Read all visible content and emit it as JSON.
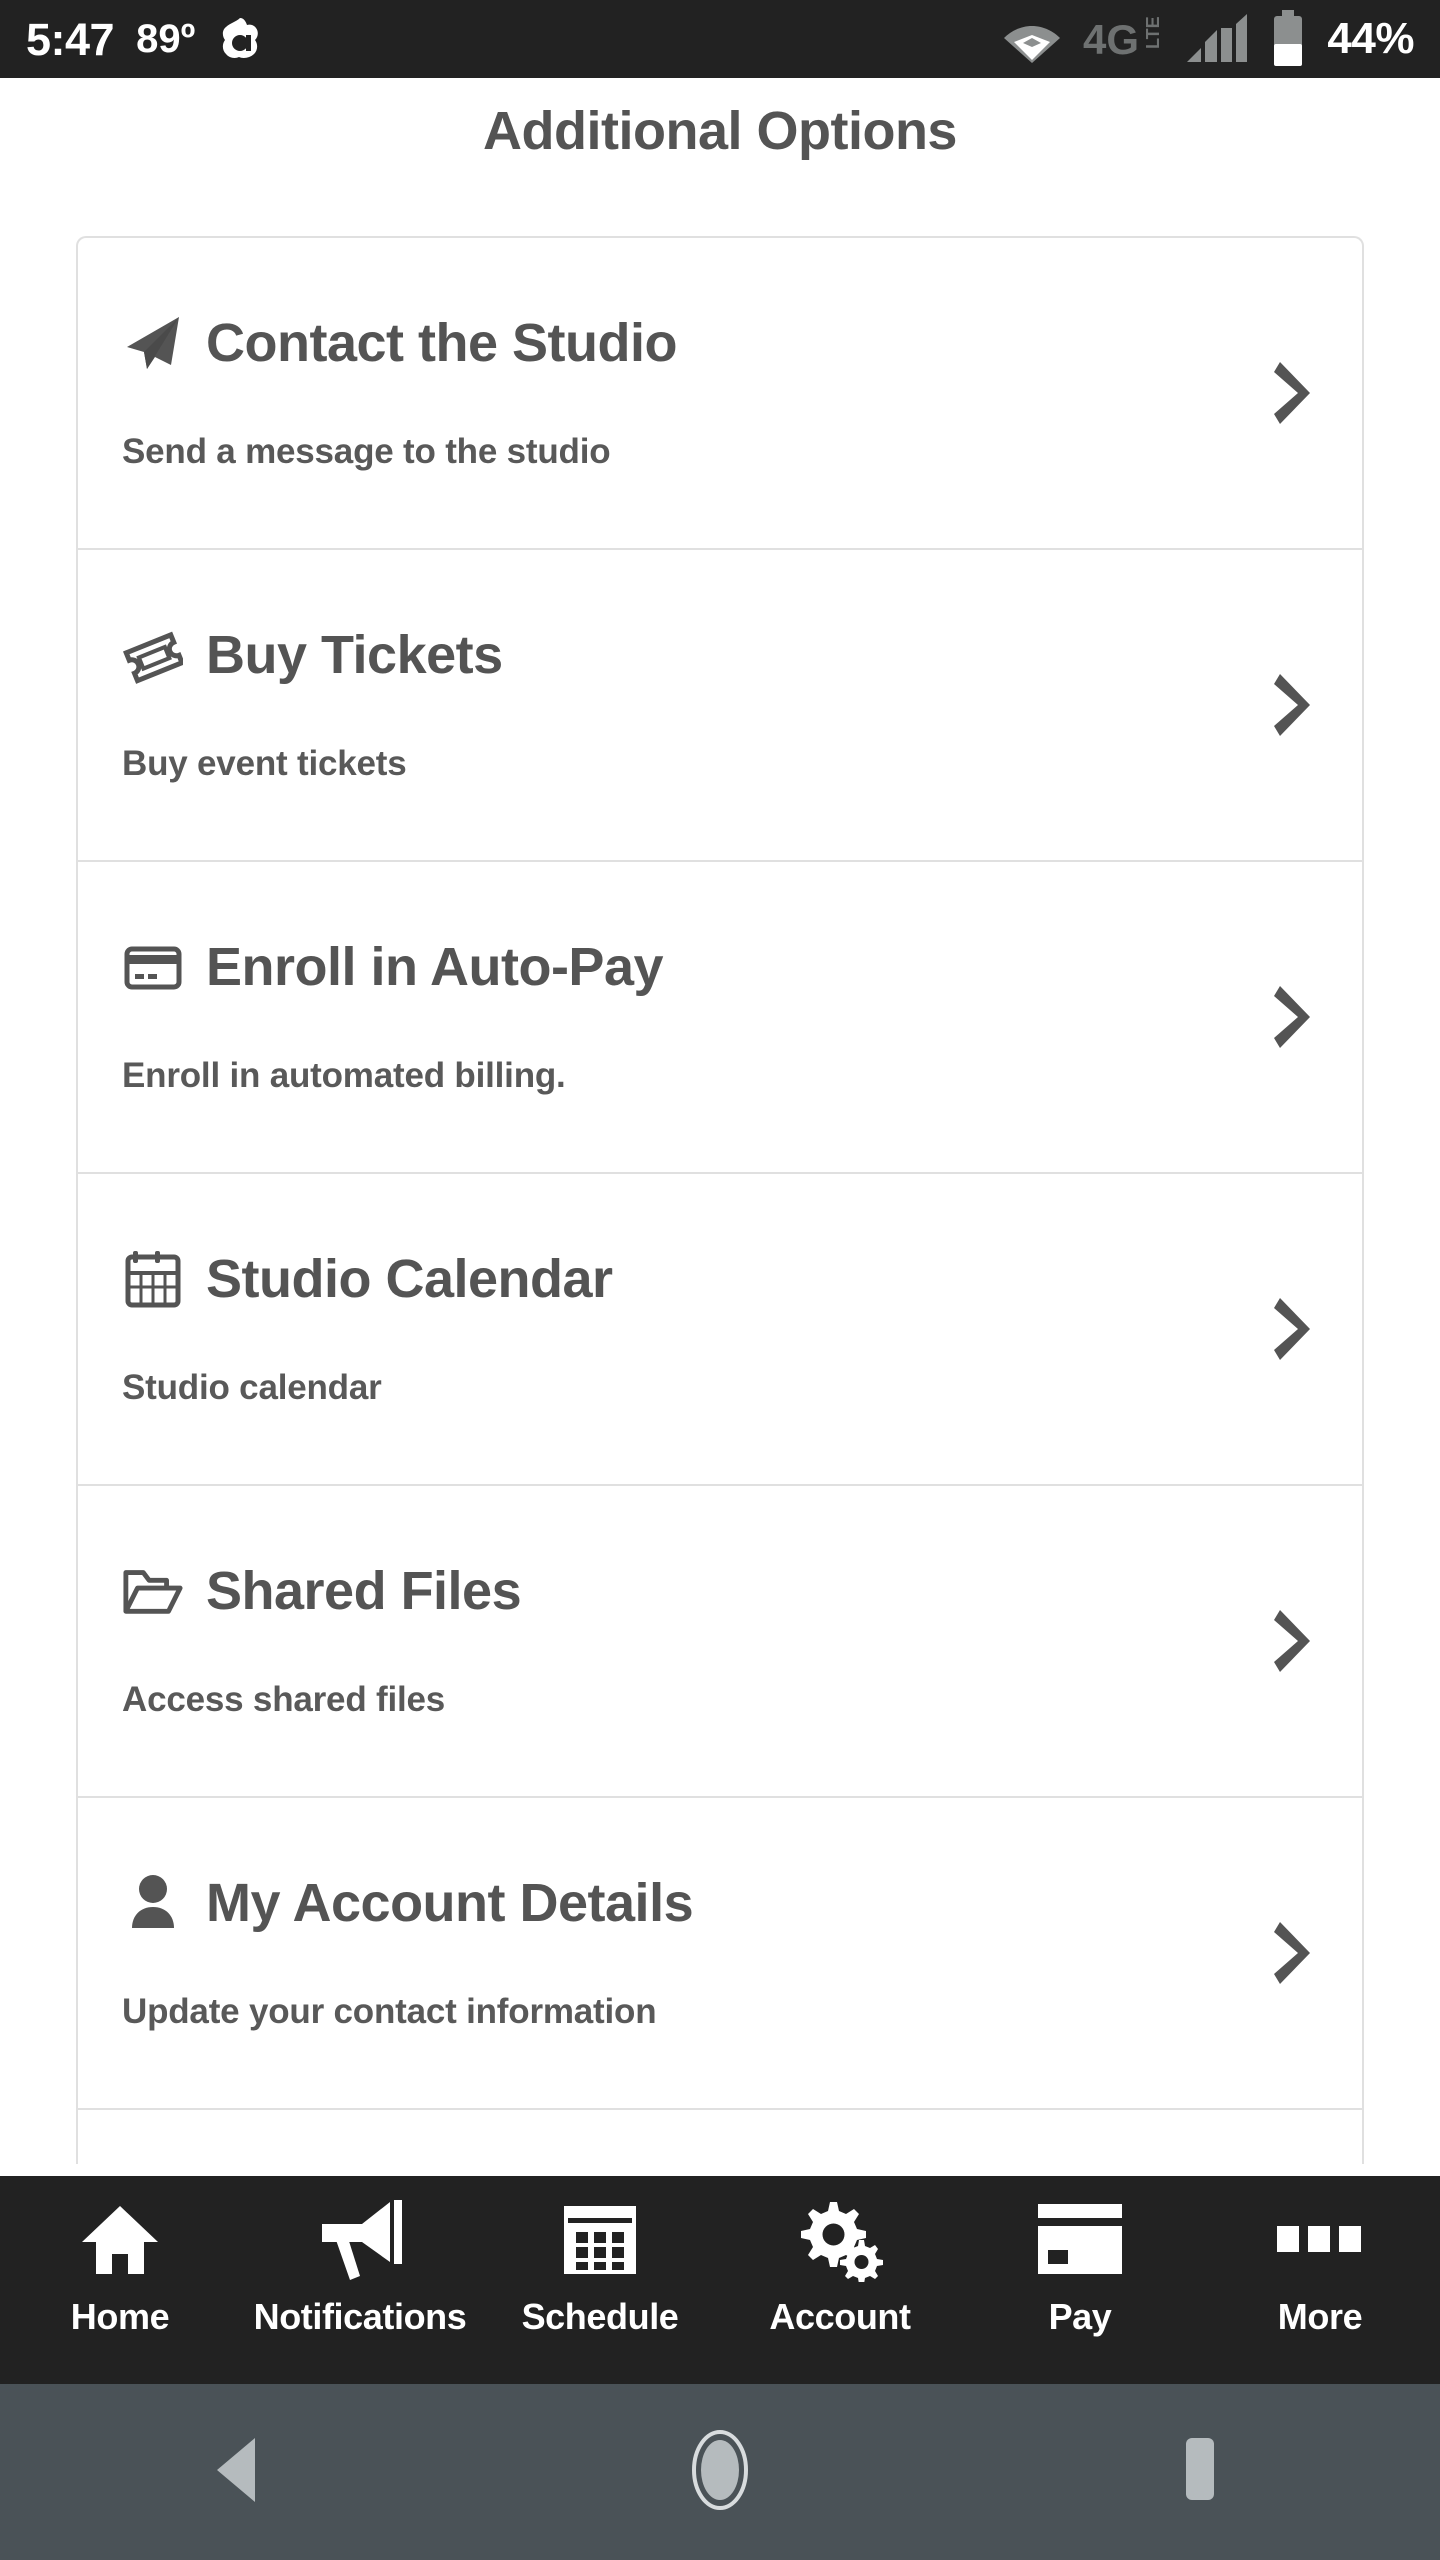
{
  "status_bar": {
    "time": "5:47",
    "temperature": "89º",
    "weather_icon": "weather-app-icon",
    "wifi_icon": "wifi-icon",
    "network_label": "4G LTE",
    "signal_icon": "cellular-signal-icon",
    "battery_icon": "battery-icon",
    "battery_percent": "44%",
    "background_color": "#222222",
    "text_color": "#ffffff"
  },
  "header": {
    "title": "Additional Options",
    "title_color": "#545454"
  },
  "options": {
    "items": [
      {
        "icon": "paper-plane-icon",
        "title": "Contact the Studio",
        "subtitle": "Send a message to the studio",
        "chevron": "chevron-right-icon"
      },
      {
        "icon": "ticket-icon",
        "title": "Buy Tickets",
        "subtitle": "Buy event tickets",
        "chevron": "chevron-right-icon"
      },
      {
        "icon": "credit-card-icon",
        "title": "Enroll in Auto-Pay",
        "subtitle": "Enroll in automated billing.",
        "chevron": "chevron-right-icon"
      },
      {
        "icon": "calendar-icon",
        "title": "Studio Calendar",
        "subtitle": "Studio calendar",
        "chevron": "chevron-right-icon"
      },
      {
        "icon": "open-folder-icon",
        "title": "Shared Files",
        "subtitle": "Access shared files",
        "chevron": "chevron-right-icon"
      },
      {
        "icon": "person-icon",
        "title": "My Account Details",
        "subtitle": "Update your contact information",
        "chevron": "chevron-right-icon"
      },
      {
        "icon": "",
        "title": "",
        "subtitle": "",
        "chevron": ""
      }
    ],
    "border_color": "#e0e0e0",
    "background_color": "#ffffff"
  },
  "tab_bar": {
    "background_color": "#222222",
    "items": [
      {
        "icon": "home-icon",
        "label": "Home"
      },
      {
        "icon": "megaphone-icon",
        "label": "Notifications"
      },
      {
        "icon": "calendar-grid-icon",
        "label": "Schedule"
      },
      {
        "icon": "gears-icon",
        "label": "Account"
      },
      {
        "icon": "credit-card-icon",
        "label": "Pay"
      },
      {
        "icon": "three-squares-icon",
        "label": "More"
      }
    ]
  },
  "android_nav": {
    "background_color": "#4a5257",
    "icon_color": "#b5bbbe",
    "buttons": [
      {
        "icon": "back-triangle-icon"
      },
      {
        "icon": "home-circle-icon"
      },
      {
        "icon": "recents-square-icon"
      }
    ]
  }
}
